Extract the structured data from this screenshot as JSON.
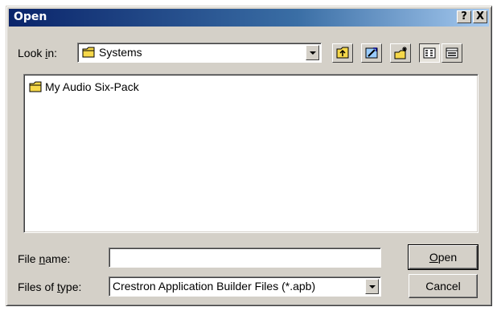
{
  "window": {
    "title": "Open",
    "help_button": "?",
    "close_button": "X"
  },
  "look_in": {
    "label_prefix": "Look ",
    "label_accel": "i",
    "label_suffix": "n:",
    "value": "Systems"
  },
  "toolbar": {
    "icons": [
      "up-one-level-icon",
      "desktop-icon",
      "new-folder-icon",
      "list-view-icon",
      "details-view-icon"
    ]
  },
  "files": [
    {
      "name": "My Audio Six-Pack",
      "icon": "folder-icon"
    }
  ],
  "file_name": {
    "label_prefix": "File ",
    "label_accel": "n",
    "label_suffix": "ame:",
    "value": ""
  },
  "files_of_type": {
    "label_prefix": "Files of ",
    "label_accel": "t",
    "label_suffix": "ype:",
    "value": "Crestron Application Builder Files (*.apb)"
  },
  "buttons": {
    "open_accel": "O",
    "open_rest": "pen",
    "cancel": "Cancel"
  },
  "colors": {
    "title_active": "#0a246a",
    "face": "#d4d0c8",
    "folder": "#f6d84a"
  }
}
